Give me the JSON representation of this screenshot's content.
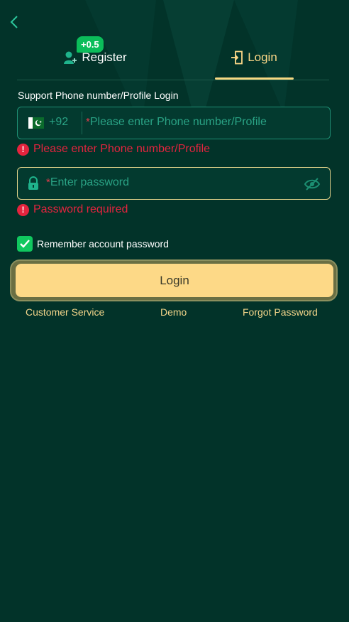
{
  "tabs": {
    "register_label": "Register",
    "register_badge": "+0.5",
    "login_label": "Login",
    "active": "login"
  },
  "form": {
    "section_title": "Support Phone number/Profile Login",
    "country_code": "+92",
    "country": "Pakistan",
    "phone_required_mark": "*",
    "phone_placeholder": "Please enter Phone number/Profile",
    "phone_error": "Please enter Phone number/Profile",
    "password_required_mark": "*",
    "password_placeholder": "Enter password",
    "password_error": "Password required",
    "remember_label": "Remember account password",
    "remember_checked": true,
    "login_button": "Login"
  },
  "links": {
    "customer_service": "Customer Service",
    "demo": "Demo",
    "forgot_password": "Forgot Password"
  },
  "colors": {
    "background": "#023329",
    "accent_gold": "#fdd887",
    "error_red": "#e4243e",
    "badge_green": "#0bbd5a",
    "field_border": "#1f8f74"
  },
  "icons": {
    "back": "chevron-left-icon",
    "register": "user-add-icon",
    "login": "login-door-icon",
    "lock": "lock-icon",
    "eye": "eye-off-icon",
    "error": "exclamation-circle-icon",
    "check": "checkmark-icon"
  }
}
